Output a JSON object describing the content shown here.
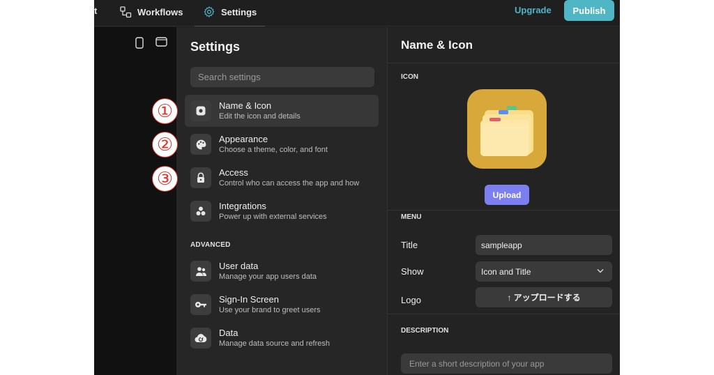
{
  "topbar": {
    "cut_label": "t",
    "workflows_label": "Workflows",
    "settings_label": "Settings",
    "upgrade_label": "Upgrade",
    "publish_label": "Publish",
    "icons": [
      "workflows-icon",
      "gear-icon",
      "phone-icon",
      "tablet-icon"
    ]
  },
  "settings": {
    "title": "Settings",
    "search_placeholder": "Search settings",
    "items": [
      {
        "title": "Name & Icon",
        "subtitle": "Edit the icon and details",
        "icon": "app-icon"
      },
      {
        "title": "Appearance",
        "subtitle": "Choose a theme, color, and font",
        "icon": "palette-icon"
      },
      {
        "title": "Access",
        "subtitle": "Control who can access the app and how",
        "icon": "lock-icon"
      },
      {
        "title": "Integrations",
        "subtitle": "Power up with external services",
        "icon": "integrations-icon"
      }
    ],
    "advanced_label": "ADVANCED",
    "advanced_items": [
      {
        "title": "User data",
        "subtitle": "Manage your app users data",
        "icon": "users-icon"
      },
      {
        "title": "Sign-In Screen",
        "subtitle": "Use your brand to greet users",
        "icon": "key-icon"
      },
      {
        "title": "Data",
        "subtitle": "Manage data source and refresh",
        "icon": "cloud-icon"
      }
    ]
  },
  "detail": {
    "title": "Name & Icon",
    "icon_label": "ICON",
    "upload_label": "Upload",
    "menu_label": "MENU",
    "title_label": "Title",
    "title_value": "sampleapp",
    "show_label": "Show",
    "show_value": "Icon and Title",
    "logo_label": "Logo",
    "logo_button": "↑  アップロードする",
    "description_label": "DESCRIPTION",
    "description_placeholder": "Enter a short description of your app"
  },
  "annotations": [
    "①",
    "②",
    "③"
  ],
  "colors": {
    "accent": "#4fb6c5",
    "upload": "#7b7ff0",
    "annotation": "#e3352b",
    "app_icon": "#d8a93a"
  }
}
